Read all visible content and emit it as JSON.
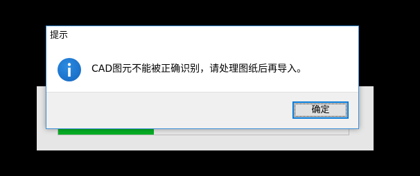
{
  "background_window": {
    "progress": 0.33,
    "progress_color": "#06b025"
  },
  "dialog": {
    "title": "提示",
    "icon": "information-icon",
    "message": "CAD图元不能被正确识别，请处理图纸后再导入。",
    "ok_label": "确定",
    "accent_color": "#0078d7"
  }
}
